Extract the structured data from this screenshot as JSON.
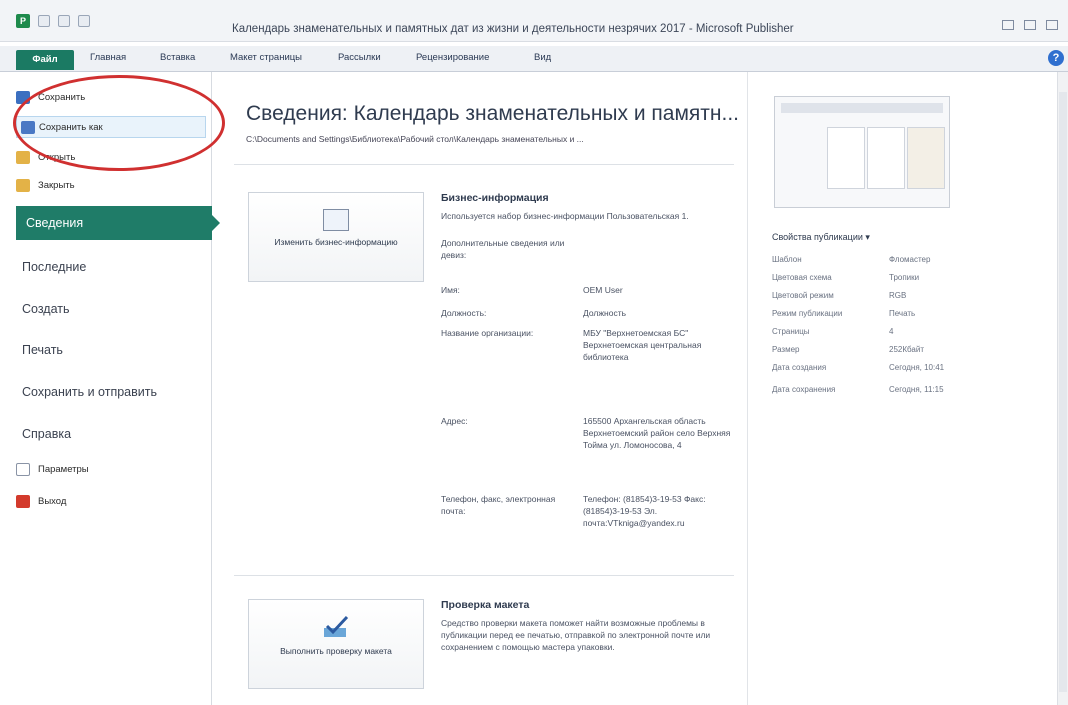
{
  "window": {
    "title": "Календарь знаменательных и памятных дат из жизни и деятельности незрячих 2017 - Microsoft Publisher"
  },
  "ribbon": {
    "tabs": [
      "Файл",
      "Главная",
      "Вставка",
      "Макет страницы",
      "Рассылки",
      "Рецензирование",
      "Вид"
    ]
  },
  "backstage": {
    "commands": [
      {
        "label": "Сохранить",
        "icon": "save-icon"
      },
      {
        "label": "Сохранить как",
        "icon": "save-as-icon"
      },
      {
        "label": "Открыть",
        "icon": "open-folder-icon"
      },
      {
        "label": "Закрыть",
        "icon": "close-folder-icon"
      }
    ],
    "nav": [
      "Сведения",
      "Последние",
      "Создать",
      "Печать",
      "Сохранить и отправить",
      "Справка"
    ],
    "bottom": [
      {
        "label": "Параметры",
        "icon": "options-icon"
      },
      {
        "label": "Выход",
        "icon": "exit-icon"
      }
    ],
    "active": "Сведения"
  },
  "info": {
    "heading": "Сведения: Календарь знаменательных и памятн...",
    "path": "C:\\Documents and Settings\\Библиотека\\Рабочий стол\\Календарь знаменательных и ...",
    "business": {
      "button": "Изменить бизнес-информацию",
      "title": "Бизнес-информация",
      "desc": "Используется набор бизнес-информации Пользовательская 1.",
      "extra": "Дополнительные сведения или девиз:",
      "fields": [
        {
          "label": "Имя:",
          "value": "OEM User"
        },
        {
          "label": "Должность:",
          "value": "Должность"
        },
        {
          "label": "Название организации:",
          "value": "МБУ \"Верхнетоемская БС\" Верхнетоемская центральная библиотека"
        },
        {
          "label": "Адрес:",
          "value": "165500 Архангельская область Верхнетоемский район село Верхняя Тойма ул. Ломоносова, 4"
        },
        {
          "label": "Телефон, факс, электронная почта:",
          "value": "Телефон: (81854)3-19-53 Факс: (81854)3-19-53 Эл. почта:VTkniga@yandex.ru"
        }
      ]
    },
    "check": {
      "button": "Выполнить проверку макета",
      "title": "Проверка макета",
      "desc": "Средство проверки макета поможет найти возможные проблемы в публикации перед ее печатью, отправкой по электронной почте или сохранением с помощью мастера упаковки."
    }
  },
  "properties": {
    "title": "Свойства публикации ▾",
    "rows": [
      {
        "label": "Шаблон",
        "value": "Фломастер"
      },
      {
        "label": "Цветовая схема",
        "value": "Тропики"
      },
      {
        "label": "Цветовой режим",
        "value": "RGB"
      },
      {
        "label": "Режим публикации",
        "value": "Печать"
      },
      {
        "label": "Страницы",
        "value": "4"
      },
      {
        "label": "Размер",
        "value": "252Кбайт"
      },
      {
        "label": "Дата создания",
        "value": "Сегодня, 10:41"
      },
      {
        "label": "Дата сохранения",
        "value": "Сегодня, 11:15"
      }
    ]
  },
  "colors": {
    "accent": "#1f7c68",
    "highlight_circle": "#d03030"
  }
}
